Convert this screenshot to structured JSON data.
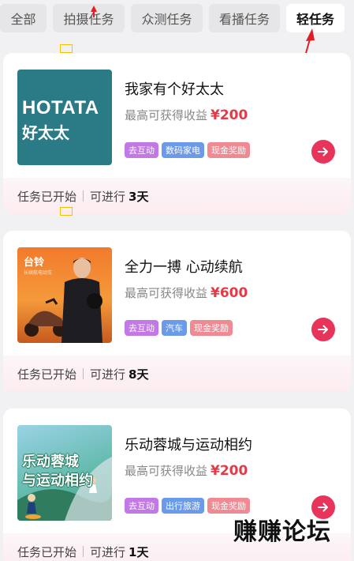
{
  "tabs": [
    {
      "label": "全部",
      "active": false
    },
    {
      "label": "拍摄任务",
      "active": false
    },
    {
      "label": "众测任务",
      "active": false
    },
    {
      "label": "看播任务",
      "active": false
    },
    {
      "label": "轻任务",
      "active": true
    }
  ],
  "tasks": [
    {
      "title": "我家有个好太太",
      "earn_label": "最高可获得收益",
      "amount": "¥200",
      "tags": [
        "去互动",
        "数码家电",
        "现金奖励"
      ],
      "thumb_lines": [
        "HOTATA",
        "好太太"
      ],
      "status": "任务已开始",
      "duration_label": "可进行",
      "duration": "3天"
    },
    {
      "title": "全力一搏 心动续航",
      "earn_label": "最高可获得收益",
      "amount": "¥600",
      "tags": [
        "去互动",
        "汽车",
        "现金奖励"
      ],
      "thumb_lines": [
        "台铃",
        "长续航电动车"
      ],
      "status": "任务已开始",
      "duration_label": "可进行",
      "duration": "8天"
    },
    {
      "title": "乐动蓉城与运动相约",
      "earn_label": "最高可获得收益",
      "amount": "¥200",
      "tags": [
        "去互动",
        "出行旅游",
        "现金奖励"
      ],
      "thumb_lines": [
        "乐动蓉城",
        "与运动相约"
      ],
      "status": "任务已开始",
      "duration_label": "可进行",
      "duration": "1天"
    }
  ],
  "watermark": "赚赚论坛",
  "colors": {
    "accent": "#e8345a",
    "amount": "#e33a48",
    "background": "#f1f1f3"
  },
  "icons": {
    "go": "arrow-right-icon"
  }
}
